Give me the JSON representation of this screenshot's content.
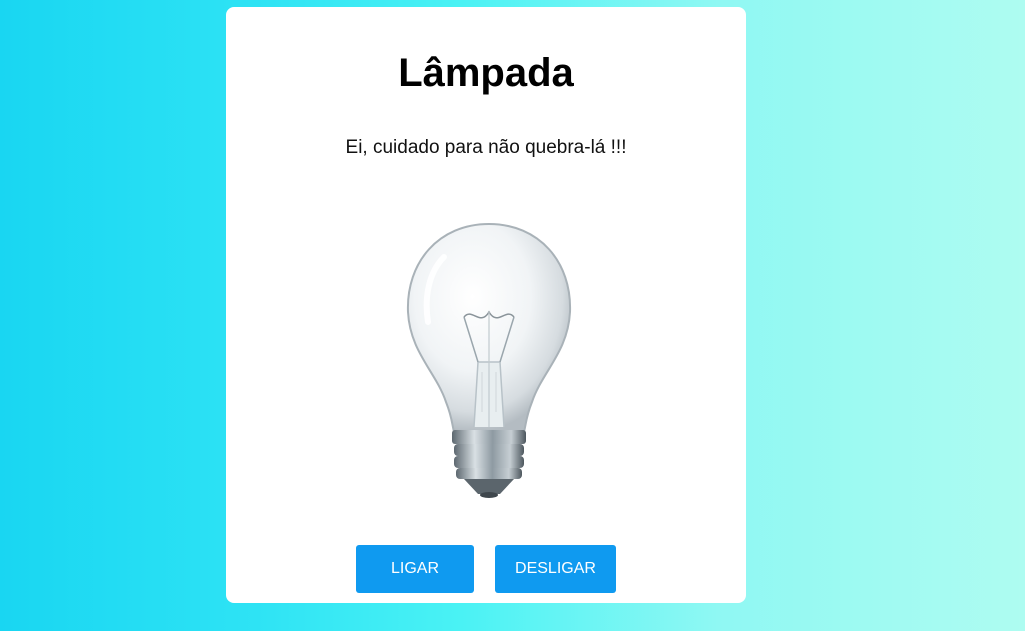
{
  "card": {
    "title": "Lâmpada",
    "subtitle": "Ei, cuidado para não quebra-lá !!!"
  },
  "bulb": {
    "icon": "lightbulb-off-icon",
    "state": "off"
  },
  "buttons": {
    "on_label": "LIGAR",
    "off_label": "DESLIGAR",
    "color": "#0f9af0"
  }
}
